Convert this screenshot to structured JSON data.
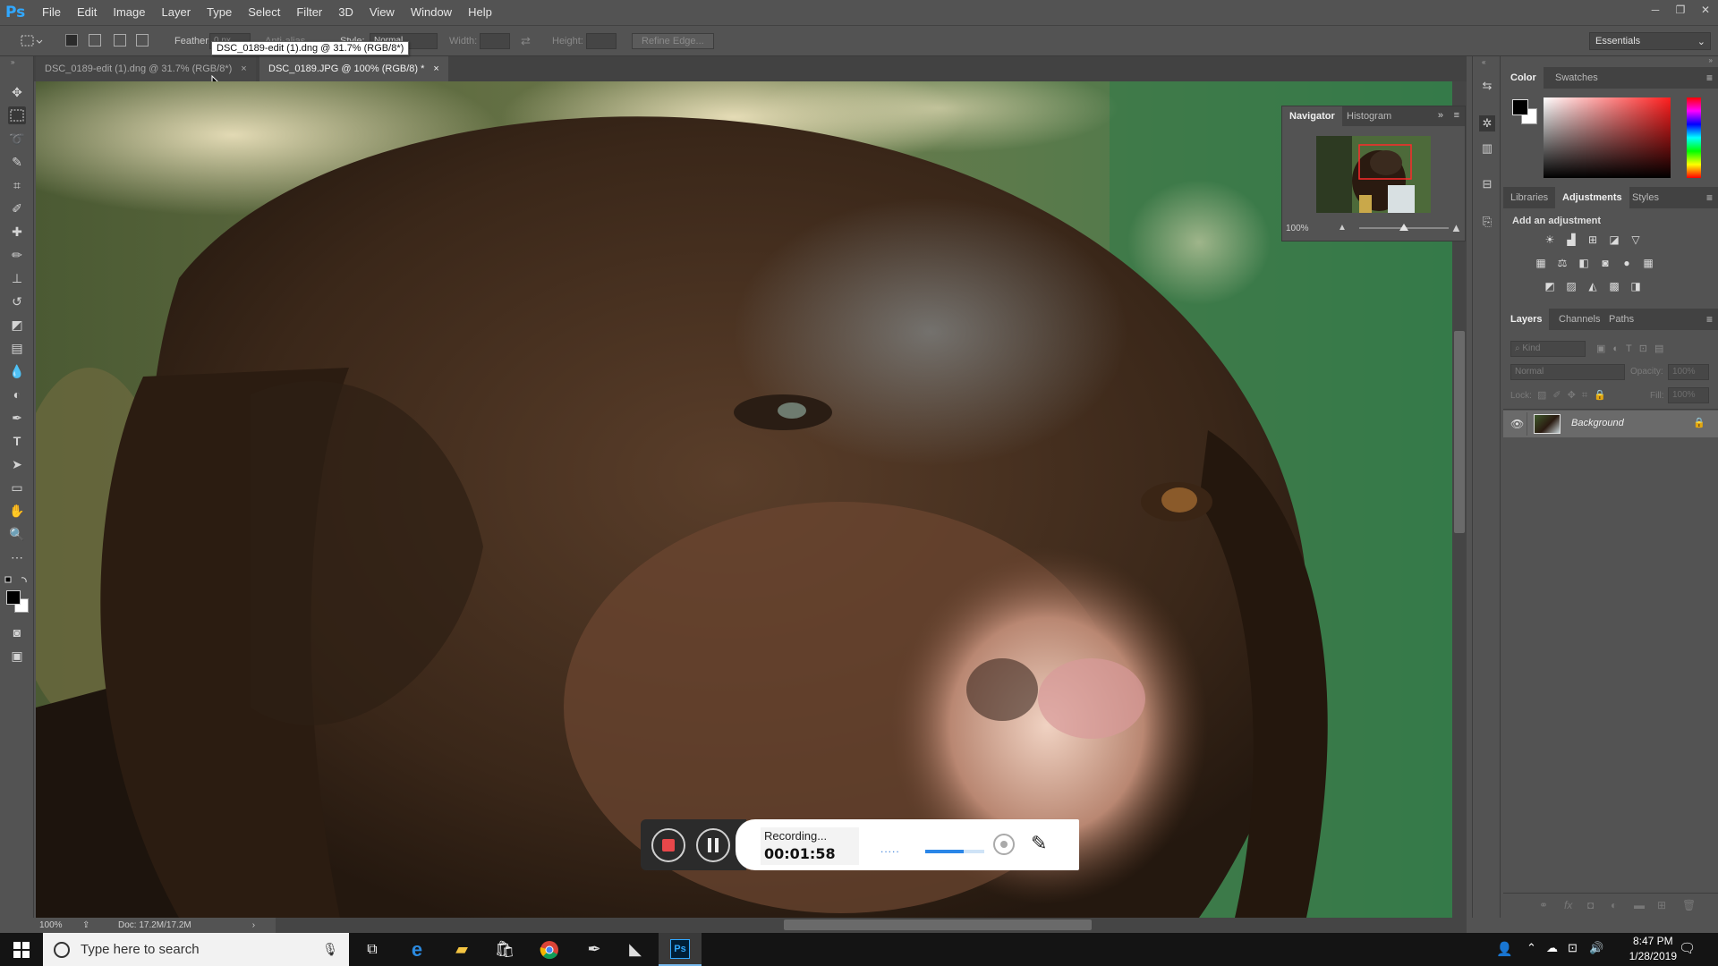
{
  "app": {
    "logo": "Ps"
  },
  "menu": [
    "File",
    "Edit",
    "Image",
    "Layer",
    "Type",
    "Select",
    "Filter",
    "3D",
    "View",
    "Window",
    "Help"
  ],
  "window_controls": {
    "minimize": "─",
    "restore": "❐",
    "close": "✕"
  },
  "options_bar": {
    "feather_label": "Feather:",
    "feather_value": "0 px",
    "antialias_label": "Anti-alias",
    "style_label": "Style:",
    "style_value": "Normal",
    "width_label": "Width:",
    "height_label": "Height:",
    "refine_edge": "Refine Edge...",
    "workspace": "Essentials"
  },
  "tooltip": "DSC_0189-edit (1).dng @ 31.7% (RGB/8*)",
  "doc_tabs": [
    {
      "label": "DSC_0189-edit (1).dng @ 31.7% (RGB/8*)",
      "close": "×",
      "active": false
    },
    {
      "label": "DSC_0189.JPG @ 100% (RGB/8) *",
      "close": "×",
      "active": true
    }
  ],
  "status": {
    "zoom": "100%",
    "doc": "Doc: 17.2M/17.2M"
  },
  "navigator": {
    "tabs": [
      "Navigator",
      "Histogram"
    ],
    "zoom": "100%",
    "slider_level": 0.5
  },
  "color_panel": {
    "tabs": [
      "Color",
      "Swatches"
    ],
    "foreground": "#000000",
    "background": "#ffffff"
  },
  "adjustments_panel": {
    "tabs": [
      "Libraries",
      "Adjustments",
      "Styles"
    ],
    "title": "Add an adjustment"
  },
  "layers_panel": {
    "tabs": [
      "Layers",
      "Channels",
      "Paths"
    ],
    "filter_placeholder": "Kind",
    "blend_mode": "Normal",
    "opacity_label": "Opacity:",
    "opacity_value": "100%",
    "lock_label": "Lock:",
    "fill_label": "Fill:",
    "fill_value": "100%",
    "layers": [
      {
        "name": "Background",
        "visible": true,
        "locked": true
      }
    ]
  },
  "recording": {
    "status": "Recording...",
    "time": "00:01:58",
    "dots": ".....",
    "volume_level": 0.65
  },
  "taskbar": {
    "search_placeholder": "Type here to search",
    "time": "8:47 PM",
    "date": "1/28/2019"
  },
  "colors": {
    "ui_bg": "#535353",
    "ui_dark": "#424242",
    "accent_ps": "#31a8ff",
    "record_red": "#e8474a"
  }
}
